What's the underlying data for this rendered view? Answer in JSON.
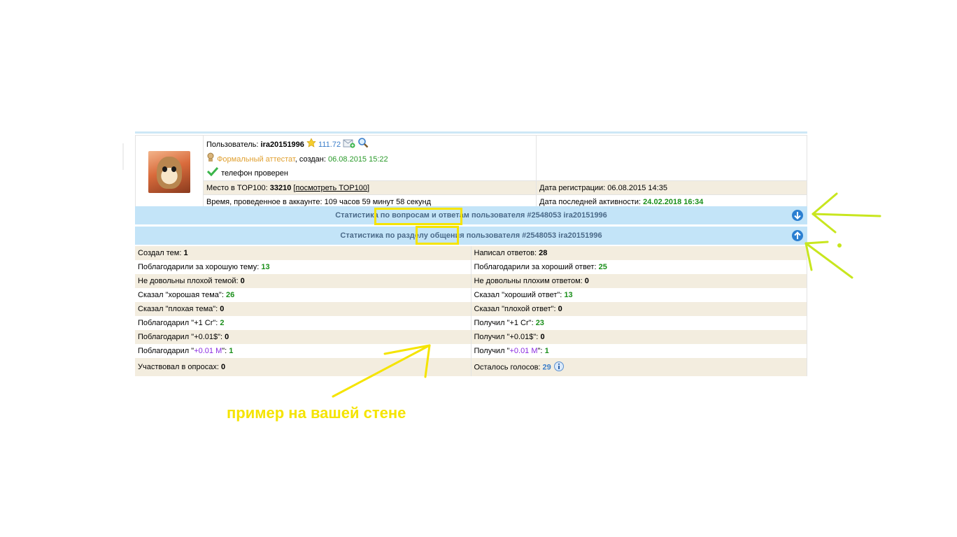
{
  "profile": {
    "user_label": "Пользователь:",
    "username": "ira20151996",
    "rating": "111.72",
    "attest": "Формальный аттестат",
    "created_label": ", создан:",
    "created_date": "06.08.2015 15:22",
    "phone": "телефон проверен",
    "top100_label": "Место в TOP100:",
    "top100_value": "33210",
    "top100_link": "посмотреть TOP100",
    "time_label": "Время, проведенное в аккаунте:",
    "time_value": "109 часов 59 минут 58 секунд",
    "reg_label": "Дата регистрации:",
    "reg_value": "06.08.2015 14:35",
    "last_label": "Дата последней активности:",
    "last_value": "24.02.2018 16:34"
  },
  "sections": {
    "qa_title": "Статистика по вопросам и ответам пользователя #2548053 ira20151996",
    "chat_title": "Статистика по разделу общения пользователя #2548053 ira20151996"
  },
  "stats": {
    "rows": [
      {
        "l_label": "Создал тем:",
        "l_value": "1",
        "r_label": "Написал ответов:",
        "r_value": "28"
      },
      {
        "l_label": "Поблагодарили за хорошую тему:",
        "l_value": "13",
        "r_label": "Поблагодарили за хороший ответ:",
        "r_value": "25"
      },
      {
        "l_label": "Не довольны плохой темой:",
        "l_value": "0",
        "r_label": "Не довольны плохим ответом:",
        "r_value": "0"
      },
      {
        "l_label": "Сказал \"хорошая тема\":",
        "l_value": "26",
        "r_label": "Сказал \"хороший ответ\":",
        "r_value": "13"
      },
      {
        "l_label": "Сказал \"плохая тема\":",
        "l_value": "0",
        "r_label": "Сказал \"плохой ответ\":",
        "r_value": "0"
      },
      {
        "l_label": "Поблагодарил \"+1 Cr\":",
        "l_value": "2",
        "r_label": "Получил \"+1 Cr\":",
        "r_value": "23"
      },
      {
        "l_label": "Поблагодарил \"+0.01$\":",
        "l_value": "0",
        "r_label": "Получил \"+0.01$\":",
        "r_value": "0"
      },
      {
        "l_label_a": "Поблагодарил \"",
        "l_label_m": "+0.01 M",
        "l_label_b": "\":",
        "l_value": "1",
        "r_label_a": "Получил \"",
        "r_label_m": "+0.01 M",
        "r_label_b": "\":",
        "r_value": "1"
      },
      {
        "l_label": "Участвовал в опросах:",
        "l_value": "0",
        "r_label": "Осталось голосов:",
        "r_value": "29"
      }
    ]
  },
  "annotation": {
    "caption": "пример на вашей стене"
  },
  "colors": {
    "section_bar": "#c3e4f8",
    "beige_row": "#f3eddf",
    "highlight": "#f5e400",
    "arrow_green": "#c8e61e"
  }
}
